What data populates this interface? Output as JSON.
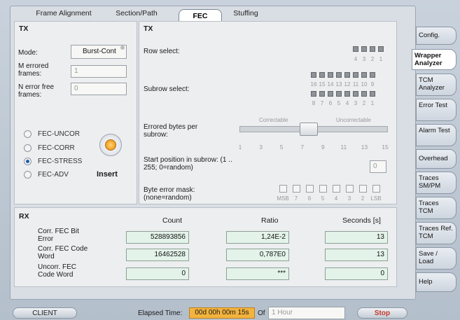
{
  "tabs": [
    "Frame Alignment",
    "Section/Path",
    "FEC",
    "Stuffing"
  ],
  "tx_left": {
    "title": "TX",
    "mode_label": "Mode:",
    "mode_value": "Burst-Cont",
    "m_errored_label": "M errored frames:",
    "m_errored_value": "1",
    "n_errorfree_label": "N error free frames:",
    "n_errorfree_value": "0",
    "radios": [
      "FEC-UNCOR",
      "FEC-CORR",
      "FEC-STRESS",
      "FEC-ADV"
    ],
    "selected_radio": "FEC-STRESS",
    "insert_label": "Insert"
  },
  "tx_right": {
    "title": "TX",
    "row_select_label": "Row select:",
    "row_numbers": [
      "4",
      "3",
      "2",
      "1"
    ],
    "subrow_select_label": "Subrow select:",
    "subrow_numbers_top": [
      "16",
      "15",
      "14",
      "13",
      "12",
      "11",
      "10",
      "9"
    ],
    "subrow_numbers_bottom": [
      "8",
      "7",
      "6",
      "5",
      "4",
      "3",
      "2",
      "1"
    ],
    "errored_bytes_label": "Errored bytes per subrow:",
    "correctable_label": "Correctable",
    "uncorrectable_label": "Uncorrectable",
    "slider_ticks": [
      "1",
      "3",
      "5",
      "7",
      "9",
      "11",
      "13",
      "15"
    ],
    "slider_value": 8,
    "start_position_label": "Start position in subrow: (1 .. 255; 0=random)",
    "start_position_value": "0",
    "byte_error_label": "Byte error mask: (none=random)",
    "mask_labels": [
      "MSB",
      "7",
      "6",
      "5",
      "4",
      "3",
      "2",
      "LSB"
    ]
  },
  "rx": {
    "title": "RX",
    "col_count": "Count",
    "col_ratio": "Ratio",
    "col_seconds": "Seconds [s]",
    "rows": [
      {
        "label": "Corr. FEC Bit Error",
        "count": "528893856",
        "ratio": "1,24E-2",
        "seconds": "13"
      },
      {
        "label": "Corr. FEC Code Word",
        "count": "16462528",
        "ratio": "0,787E0",
        "seconds": "13"
      },
      {
        "label": "Uncorr. FEC Code Word",
        "count": "0",
        "ratio": "***",
        "seconds": "0"
      }
    ]
  },
  "sidebar": [
    "Config.",
    "Wrapper Analyzer",
    "TCM Analyzer",
    "Error Test",
    "Alarm Test",
    "Overhead",
    "Traces SM/PM",
    "Traces TCM",
    "Traces Ref. TCM",
    "Save / Load",
    "Help"
  ],
  "sidebar_active": "Wrapper Analyzer",
  "status": {
    "client_label": "CLIENT",
    "elapsed_label": "Elapsed Time:",
    "elapsed_value": "00d 00h 00m 15s",
    "of_label": "Of",
    "duration_value": "1 Hour",
    "stop_label": "Stop"
  },
  "colors": {
    "elapsed_bg": "#f3b33c",
    "stop_text": "#c0392b",
    "radio_selected": "#1d5fb1",
    "insert_knob": "#f0a020"
  }
}
